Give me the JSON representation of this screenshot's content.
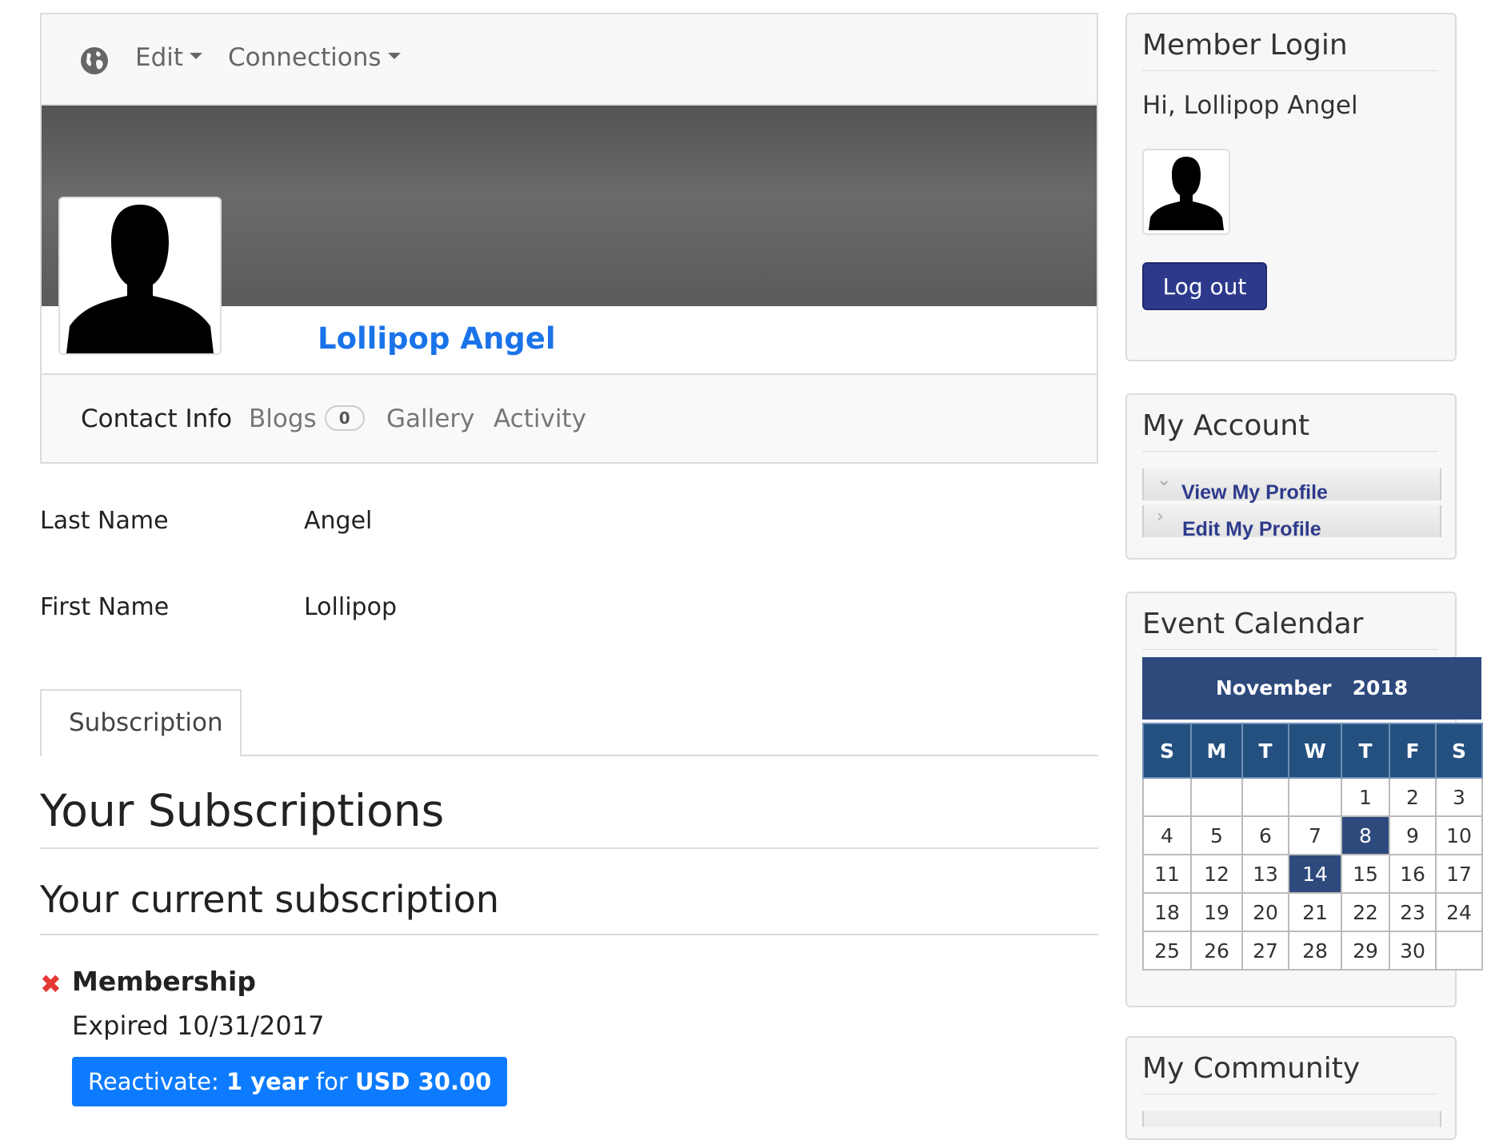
{
  "topnav": {
    "items": [
      {
        "label": "Edit"
      },
      {
        "label": "Connections"
      }
    ]
  },
  "profile": {
    "name": "Lollipop Angel",
    "tabs": [
      {
        "label": "Contact Info"
      },
      {
        "label": "Blogs",
        "badge": "0"
      },
      {
        "label": "Gallery"
      },
      {
        "label": "Activity"
      }
    ]
  },
  "fields": [
    {
      "label": "Last Name",
      "value": "Angel"
    },
    {
      "label": "First Name",
      "value": "Lollipop"
    }
  ],
  "subscription": {
    "tab_label": "Subscription",
    "heading": "Your Subscriptions",
    "current_heading": "Your current subscription",
    "status_icon": "x-mark-icon",
    "status_color": "#e53935",
    "plan": "Membership",
    "expired_text": "Expired 10/31/2017",
    "reactivate": {
      "prefix": "Reactivate: ",
      "term": "1 year",
      "middle": " for ",
      "price": "USD 30.00"
    }
  },
  "sidebar": {
    "member_login": {
      "title": "Member Login",
      "greeting": "Hi, Lollipop Angel",
      "logout_label": "Log out"
    },
    "my_account": {
      "title": "My Account",
      "links": [
        {
          "label": "View My Profile",
          "icon": "chevron-down-icon"
        },
        {
          "label": "Edit My Profile",
          "icon": "chevron-right-icon"
        }
      ]
    },
    "event_calendar": {
      "title": "Event Calendar",
      "month": "November",
      "year": "2018",
      "weekdays": [
        "S",
        "M",
        "T",
        "W",
        "T",
        "F",
        "S"
      ],
      "weeks": [
        [
          "",
          "",
          "",
          "",
          "1",
          "2",
          "3"
        ],
        [
          "4",
          "5",
          "6",
          "7",
          "8",
          "9",
          "10"
        ],
        [
          "11",
          "12",
          "13",
          "14",
          "15",
          "16",
          "17"
        ],
        [
          "18",
          "19",
          "20",
          "21",
          "22",
          "23",
          "24"
        ],
        [
          "25",
          "26",
          "27",
          "28",
          "29",
          "30",
          ""
        ]
      ],
      "highlighted_days": [
        "8",
        "14"
      ],
      "header_color": "#2e4a7d"
    },
    "my_community": {
      "title": "My Community"
    }
  },
  "colors": {
    "accent": "#1a73e8",
    "button_primary": "#0d7bff",
    "logout_button": "#2d3a8c"
  }
}
